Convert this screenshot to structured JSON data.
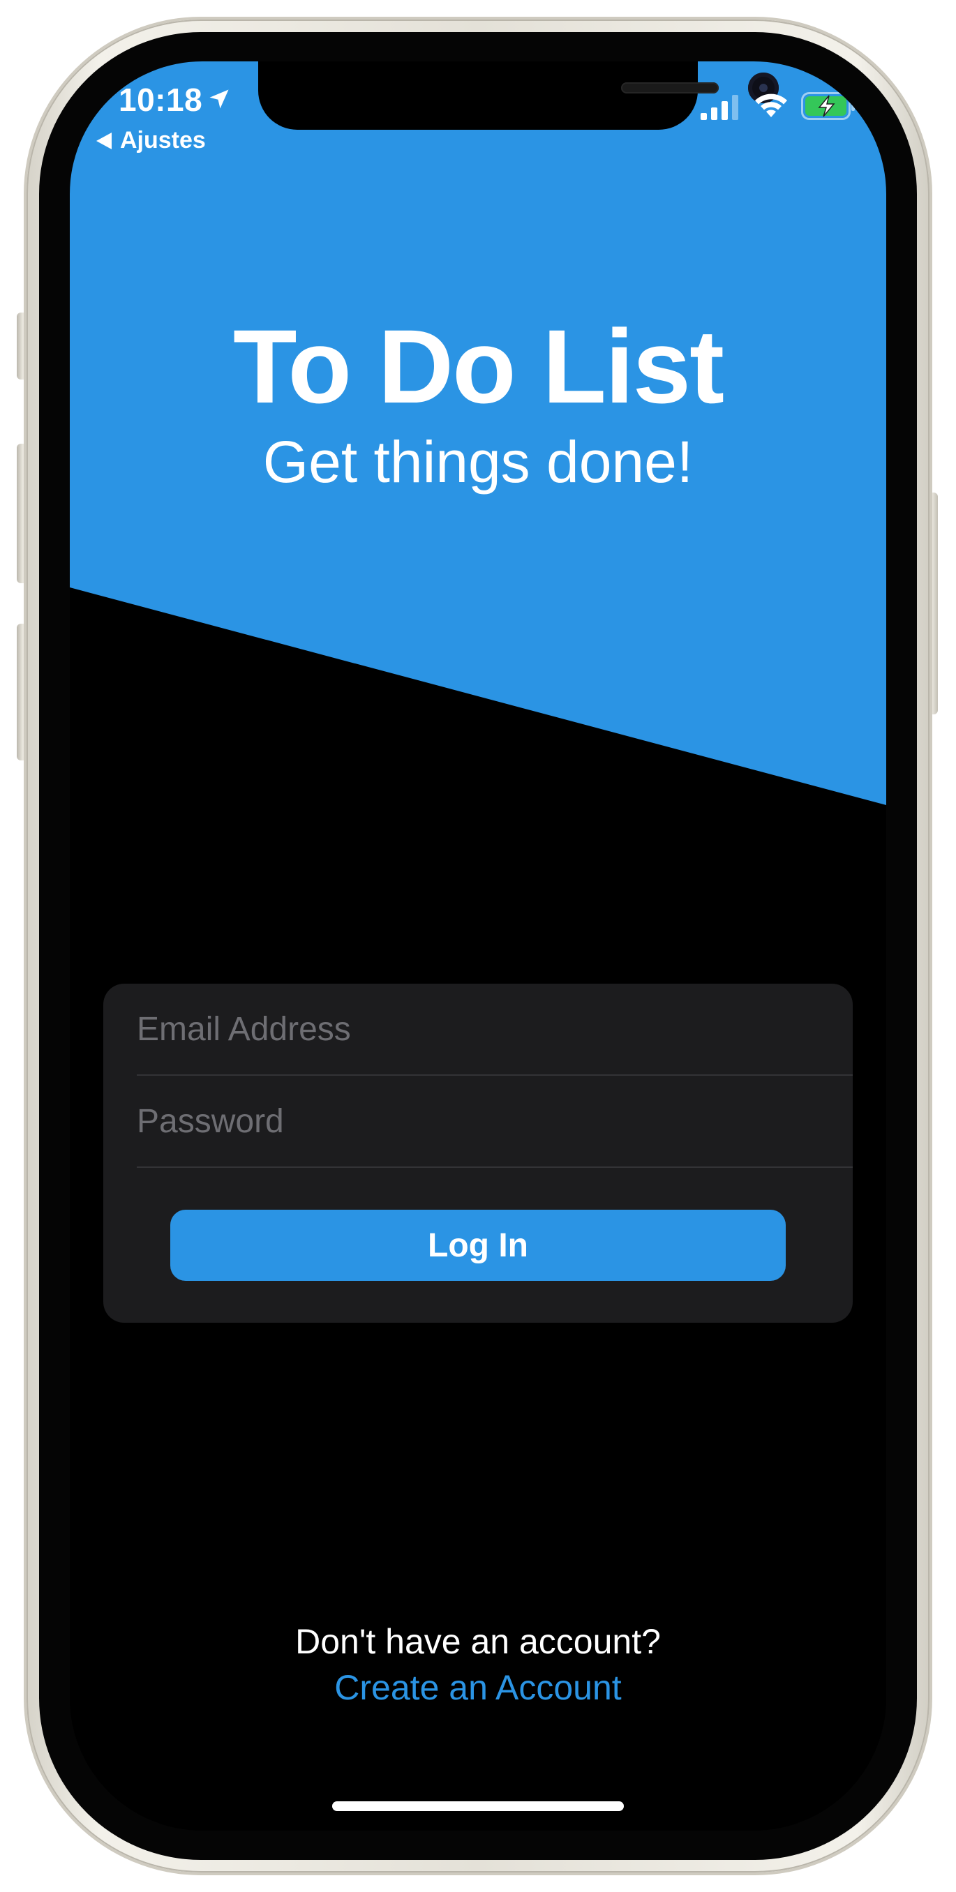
{
  "status_bar": {
    "time": "10:18",
    "back_label": "Ajustes",
    "icons": [
      "location-arrow-icon",
      "cellular-signal-icon",
      "wifi-icon",
      "battery-charging-icon"
    ]
  },
  "header": {
    "title": "To Do List",
    "subtitle": "Get things done!",
    "background_color": "#2b94e4"
  },
  "login_form": {
    "email_value": "",
    "email_placeholder": "Email Address",
    "password_value": "",
    "password_placeholder": "Password",
    "login_button_label": "Log In",
    "button_color": "#2b94e4"
  },
  "footer": {
    "prompt": "Don't have an account?",
    "create_account_link": "Create an Account",
    "link_color": "#2b94e4"
  },
  "colors": {
    "screen_background": "#000000",
    "card_background": "#1c1c1e",
    "accent": "#2b94e4",
    "battery_green": "#34c759"
  }
}
